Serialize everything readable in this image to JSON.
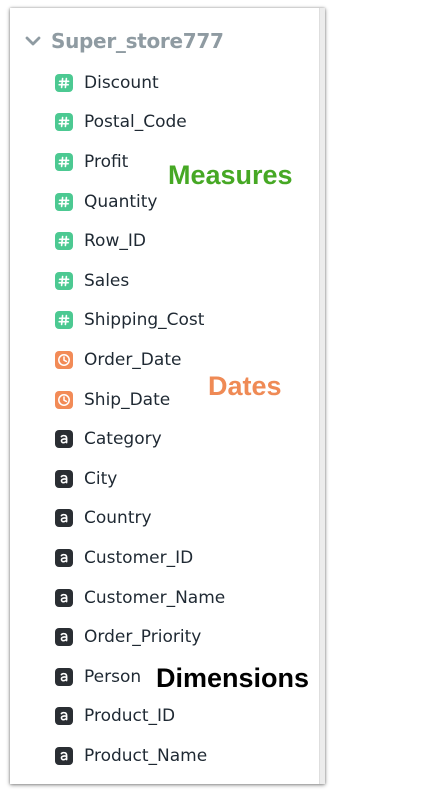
{
  "colors": {
    "measure": "#4cc992",
    "date": "#f28b57",
    "dimension": "#2a2e33",
    "measures_annotation": "#46a824",
    "dates_annotation": "#ef8a55",
    "dimensions_annotation": "#000000"
  },
  "datasource": {
    "name": "Super_store777",
    "expand_icon": "chevron-down-icon"
  },
  "fields": [
    {
      "label": "Discount",
      "type": "measure",
      "icon": "hash-icon"
    },
    {
      "label": "Postal_Code",
      "type": "measure",
      "icon": "hash-icon"
    },
    {
      "label": "Profit",
      "type": "measure",
      "icon": "hash-icon"
    },
    {
      "label": "Quantity",
      "type": "measure",
      "icon": "hash-icon"
    },
    {
      "label": "Row_ID",
      "type": "measure",
      "icon": "hash-icon"
    },
    {
      "label": "Sales",
      "type": "measure",
      "icon": "hash-icon"
    },
    {
      "label": "Shipping_Cost",
      "type": "measure",
      "icon": "hash-icon"
    },
    {
      "label": "Order_Date",
      "type": "date",
      "icon": "clock-icon"
    },
    {
      "label": "Ship_Date",
      "type": "date",
      "icon": "clock-icon"
    },
    {
      "label": "Category",
      "type": "dimension",
      "icon": "text-a-icon"
    },
    {
      "label": "City",
      "type": "dimension",
      "icon": "text-a-icon"
    },
    {
      "label": "Country",
      "type": "dimension",
      "icon": "text-a-icon"
    },
    {
      "label": "Customer_ID",
      "type": "dimension",
      "icon": "text-a-icon"
    },
    {
      "label": "Customer_Name",
      "type": "dimension",
      "icon": "text-a-icon"
    },
    {
      "label": "Order_Priority",
      "type": "dimension",
      "icon": "text-a-icon"
    },
    {
      "label": "Person",
      "type": "dimension",
      "icon": "text-a-icon"
    },
    {
      "label": "Product_ID",
      "type": "dimension",
      "icon": "text-a-icon"
    },
    {
      "label": "Product_Name",
      "type": "dimension",
      "icon": "text-a-icon"
    }
  ],
  "annotations": {
    "measures": "Measures",
    "dates": "Dates",
    "dimensions": "Dimensions"
  }
}
